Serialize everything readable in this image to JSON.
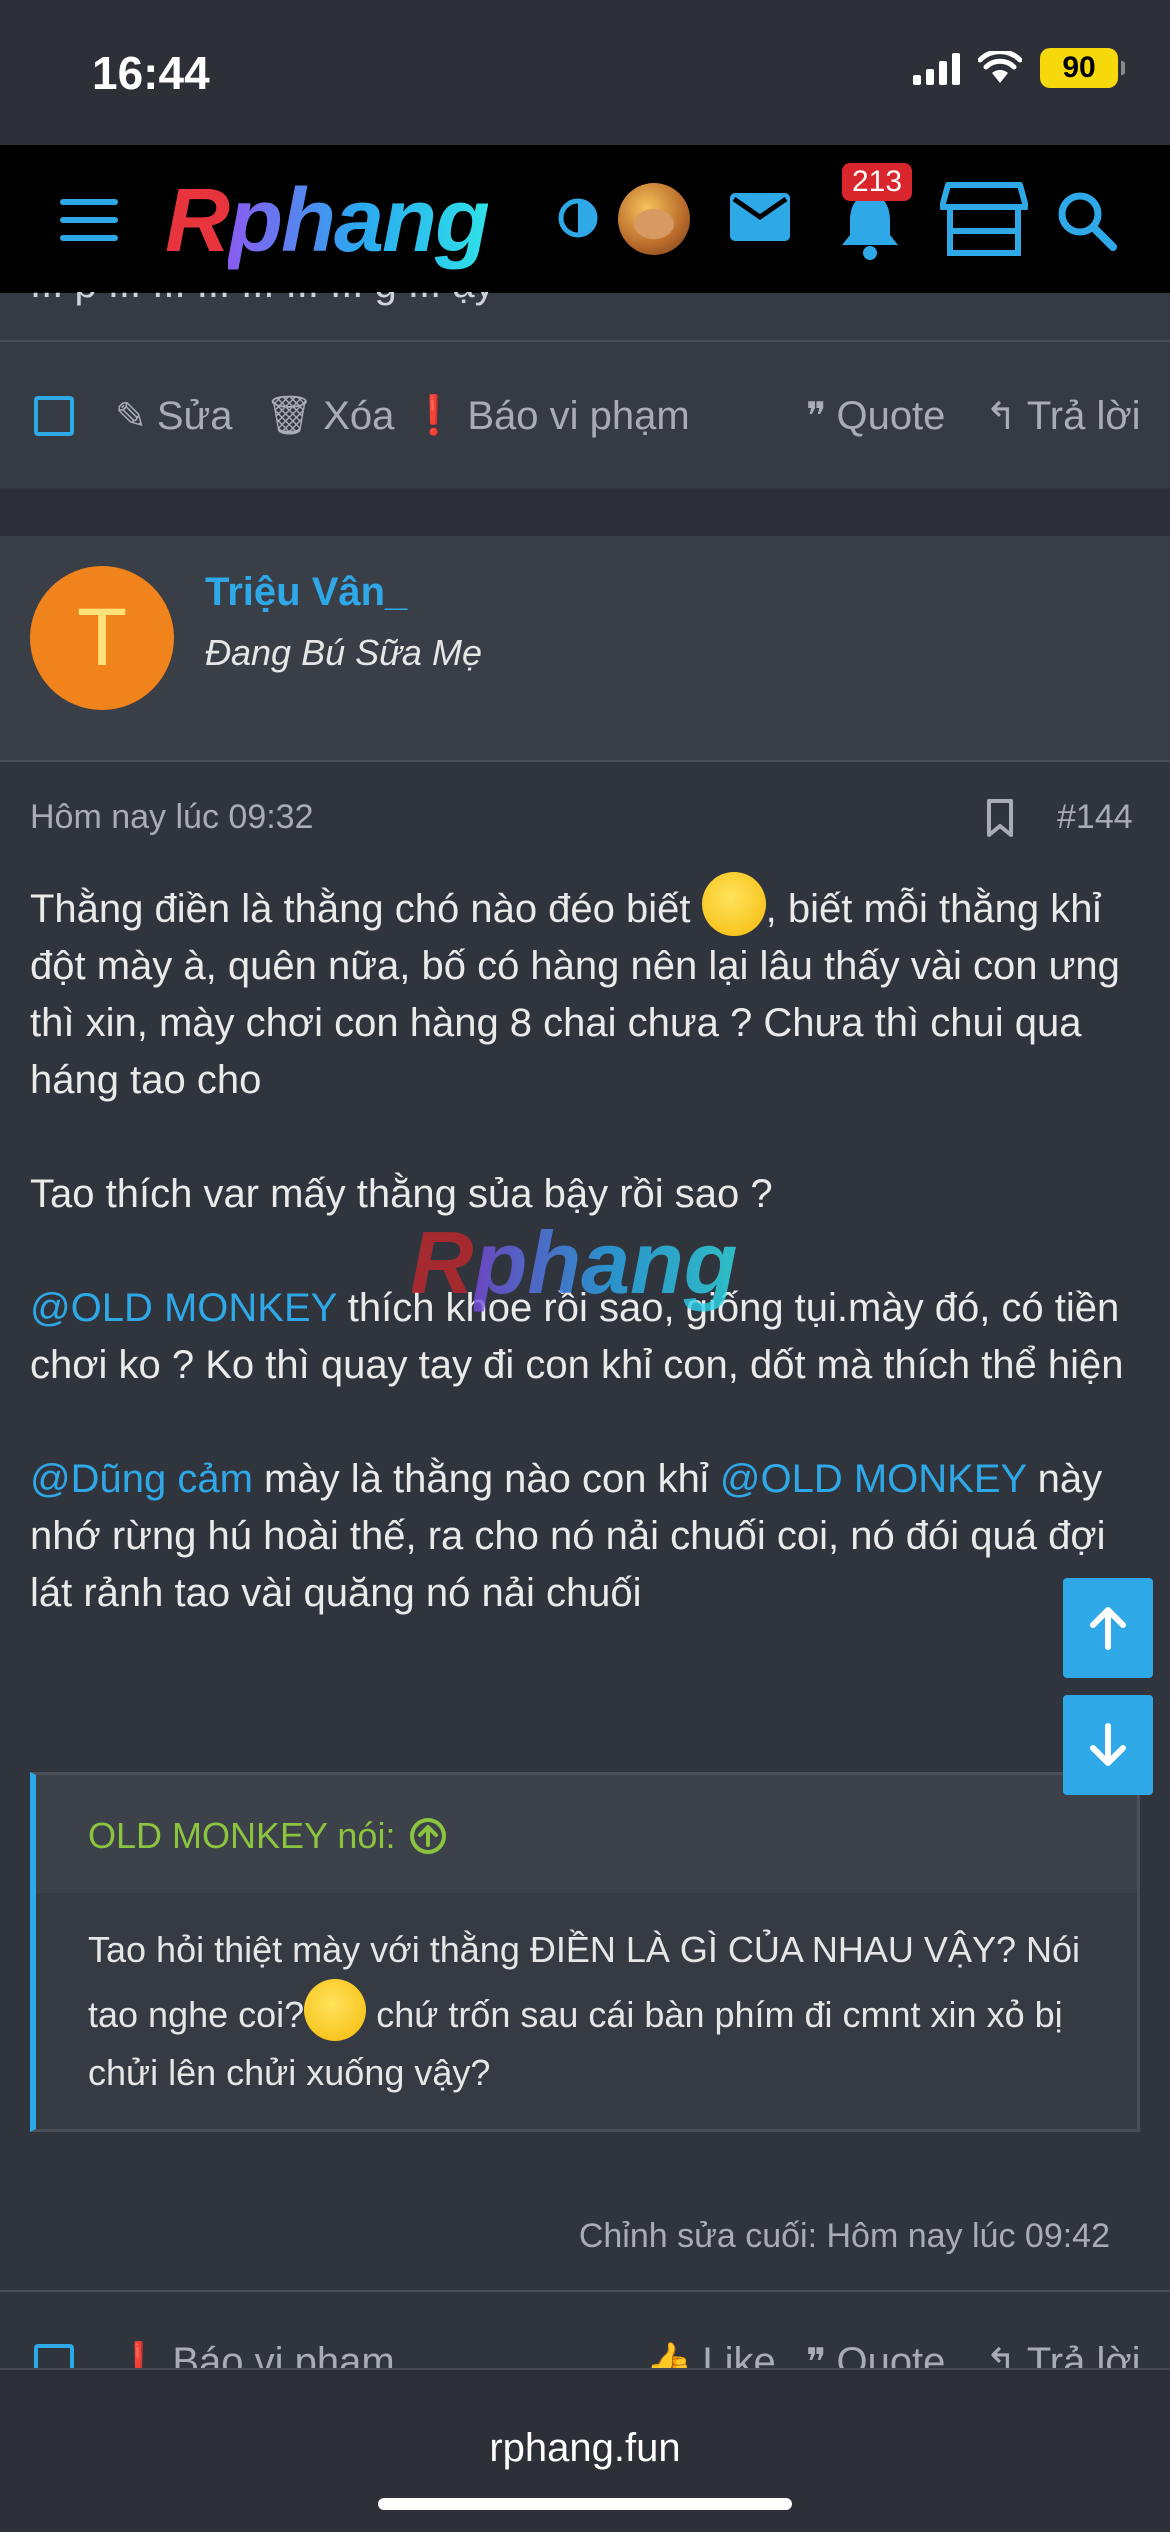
{
  "status_bar": {
    "time": "16:44",
    "battery": "90"
  },
  "header": {
    "logo_r": "R",
    "logo_rest": "phang",
    "notification_count": "213",
    "icons": [
      "menu-icon",
      "theme-toggle-icon",
      "avatar",
      "mail-icon",
      "bell-icon",
      "store-icon",
      "search-icon"
    ]
  },
  "previous_post": {
    "partial_text": "... p ... ... ... ... ... ... g ... ậy",
    "actions": {
      "edit": "Sửa",
      "delete": "Xóa",
      "report": "Báo vi phạm",
      "quote": "Quote",
      "reply": "Trả lời"
    }
  },
  "post": {
    "avatar_letter": "T",
    "username": "Triệu Vân_",
    "user_title": "Đang Bú Sữa Mẹ",
    "date": "Hôm nay lúc 09:32",
    "number": "#144",
    "paragraphs": {
      "p1_a": "Thằng điền là thằng chó nào đéo biết ",
      "p1_b": ", biết mỗi thằng khỉ đột mày à, quên nữa, bố có hàng nên lại lâu thấy vài con ưng thì xin, mày chơi con hàng 8 chai chưa ? Chưa thì chui qua háng tao cho",
      "p2": "Tao thích var mấy thằng sủa bậy rồi sao ?",
      "p3_mention": "@OLD MONKEY",
      "p3_text": " thích khoe rồi sao, giống tụi.mày đó, có tiền chơi ko ? Ko thì quay tay đi con khỉ con, dốt mà thích thể hiện",
      "p4_mention1": "@Dũng cảm",
      "p4_text1": " mày là thằng nào con khỉ ",
      "p4_mention2": "@OLD MONKEY",
      "p4_text2": " này nhớ rừng hú hoài thế, ra cho nó nải chuối coi, nó đói quá đợi lát rảnh tao vài quăng nó nải chuối"
    },
    "quote": {
      "author": "OLD MONKEY nói:",
      "text_a": "Tao hỏi thiệt mày với thằng ĐIỀN LÀ GÌ CỦA NHAU VẬY? Nói tao nghe coi?",
      "text_b": " chứ trốn sau cái bàn phím đi cmnt xin xỏ bị chửi lên chửi xuống vậy?"
    },
    "last_edited": "Chỉnh sửa cuối: Hôm nay lúc 09:42",
    "actions": {
      "report": "Báo vi phạm",
      "like": "Like",
      "quote": "Quote",
      "reply": "Trả lời"
    }
  },
  "watermark": {
    "r": "R",
    "rest": "phang"
  },
  "browser": {
    "url": "rphang.fun"
  },
  "colors": {
    "accent": "#2fa8e8",
    "quote_author": "#8bc53f",
    "avatar_bg": "#f0831b",
    "badge": "#d9262c"
  }
}
